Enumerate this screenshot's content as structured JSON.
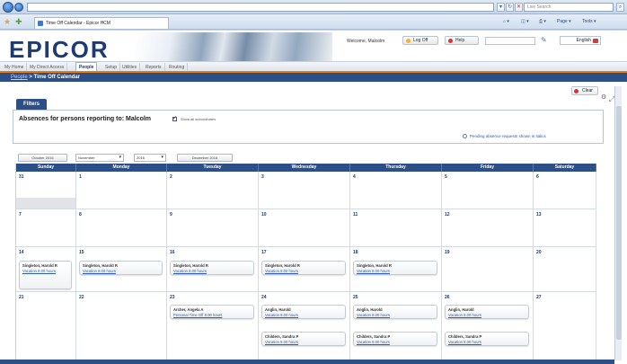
{
  "browser": {
    "tab_title": "Time Off Calendar - Epicor HCM",
    "search_placeholder": "Live Search",
    "commands": [
      "Page ▾",
      "Tools ▾"
    ]
  },
  "app": {
    "logo": "EPICOR",
    "welcome": "Welcome, Malcolm",
    "log_off": "Log Off",
    "help": "Help",
    "language": "English",
    "menu": [
      "My Home",
      "My Direct Access",
      "People",
      "Setup",
      "Utilities",
      "Reports",
      "Routing"
    ],
    "active_menu": "People",
    "breadcrumb_link": "People",
    "breadcrumb_sep": " > ",
    "breadcrumb_current": "Time Off Calendar"
  },
  "toolbar": {
    "clear_label": "Clear"
  },
  "filters": {
    "tab_label": "Filters",
    "heading": "Absences for persons reporting to: Malcolm",
    "show_all_label": "Show all subordinates",
    "pending_note": "Pending absence requests shown in italics"
  },
  "calendar_nav": {
    "prev_label": "October 2016",
    "month_value": "November",
    "year_value": "2016",
    "next_label": "December 2016"
  },
  "days_of_week": [
    "Sunday",
    "Monday",
    "Tuesday",
    "Wednesday",
    "Thursday",
    "Friday",
    "Saturday"
  ],
  "weeks": [
    {
      "days": [
        "31",
        "1",
        "2",
        "3",
        "4",
        "5",
        "6"
      ],
      "other_month": [
        true,
        false,
        false,
        false,
        false,
        false,
        false
      ]
    },
    {
      "days": [
        "7",
        "8",
        "9",
        "10",
        "11",
        "12",
        "13"
      ],
      "other_month": [
        false,
        false,
        false,
        false,
        false,
        false,
        false
      ]
    },
    {
      "days": [
        "14",
        "15",
        "16",
        "17",
        "18",
        "19",
        "20"
      ],
      "other_month": [
        false,
        false,
        false,
        false,
        false,
        false,
        false
      ]
    },
    {
      "days": [
        "21",
        "22",
        "23",
        "24",
        "25",
        "26",
        "27"
      ],
      "other_month": [
        false,
        false,
        false,
        false,
        false,
        false,
        false
      ]
    }
  ],
  "events": {
    "w3": [
      {
        "day": 0,
        "name": "Singleton, Harold R",
        "type": "Vacation 8.00 hours"
      },
      {
        "day": 1,
        "name": "Singleton, Harold R",
        "type": "Vacation 8.00 hours"
      },
      {
        "day": 2,
        "name": "Singleton, Harold R",
        "type": "Vacation 8.00 hours"
      },
      {
        "day": 3,
        "name": "Singleton, Harold R",
        "type": "Vacation 8.00 hours"
      },
      {
        "day": 4,
        "name": "Singleton, Harold R",
        "type": "Vacation 8.00 hours"
      }
    ],
    "w4_row1": [
      {
        "day": 2,
        "name": "Archer, Angela A",
        "type": "Personal Time Off 8.00 hours"
      },
      {
        "day": 3,
        "name": "Anglin, Harold",
        "type": "Vacation 8.00 hours"
      },
      {
        "day": 4,
        "name": "Anglin, Harold",
        "type": "Vacation 8.00 hours"
      },
      {
        "day": 5,
        "name": "Anglin, Harold",
        "type": "Vacation 8.00 hours"
      }
    ],
    "w4_row2": [
      {
        "day": 3,
        "name": "Childers, Sandra P",
        "type": "Vacation 8.00 hours"
      },
      {
        "day": 4,
        "name": "Childers, Sandra P",
        "type": "Vacation 8.00 hours"
      },
      {
        "day": 5,
        "name": "Childers, Sandra P",
        "type": "Vacation 8.00 hours"
      }
    ]
  }
}
